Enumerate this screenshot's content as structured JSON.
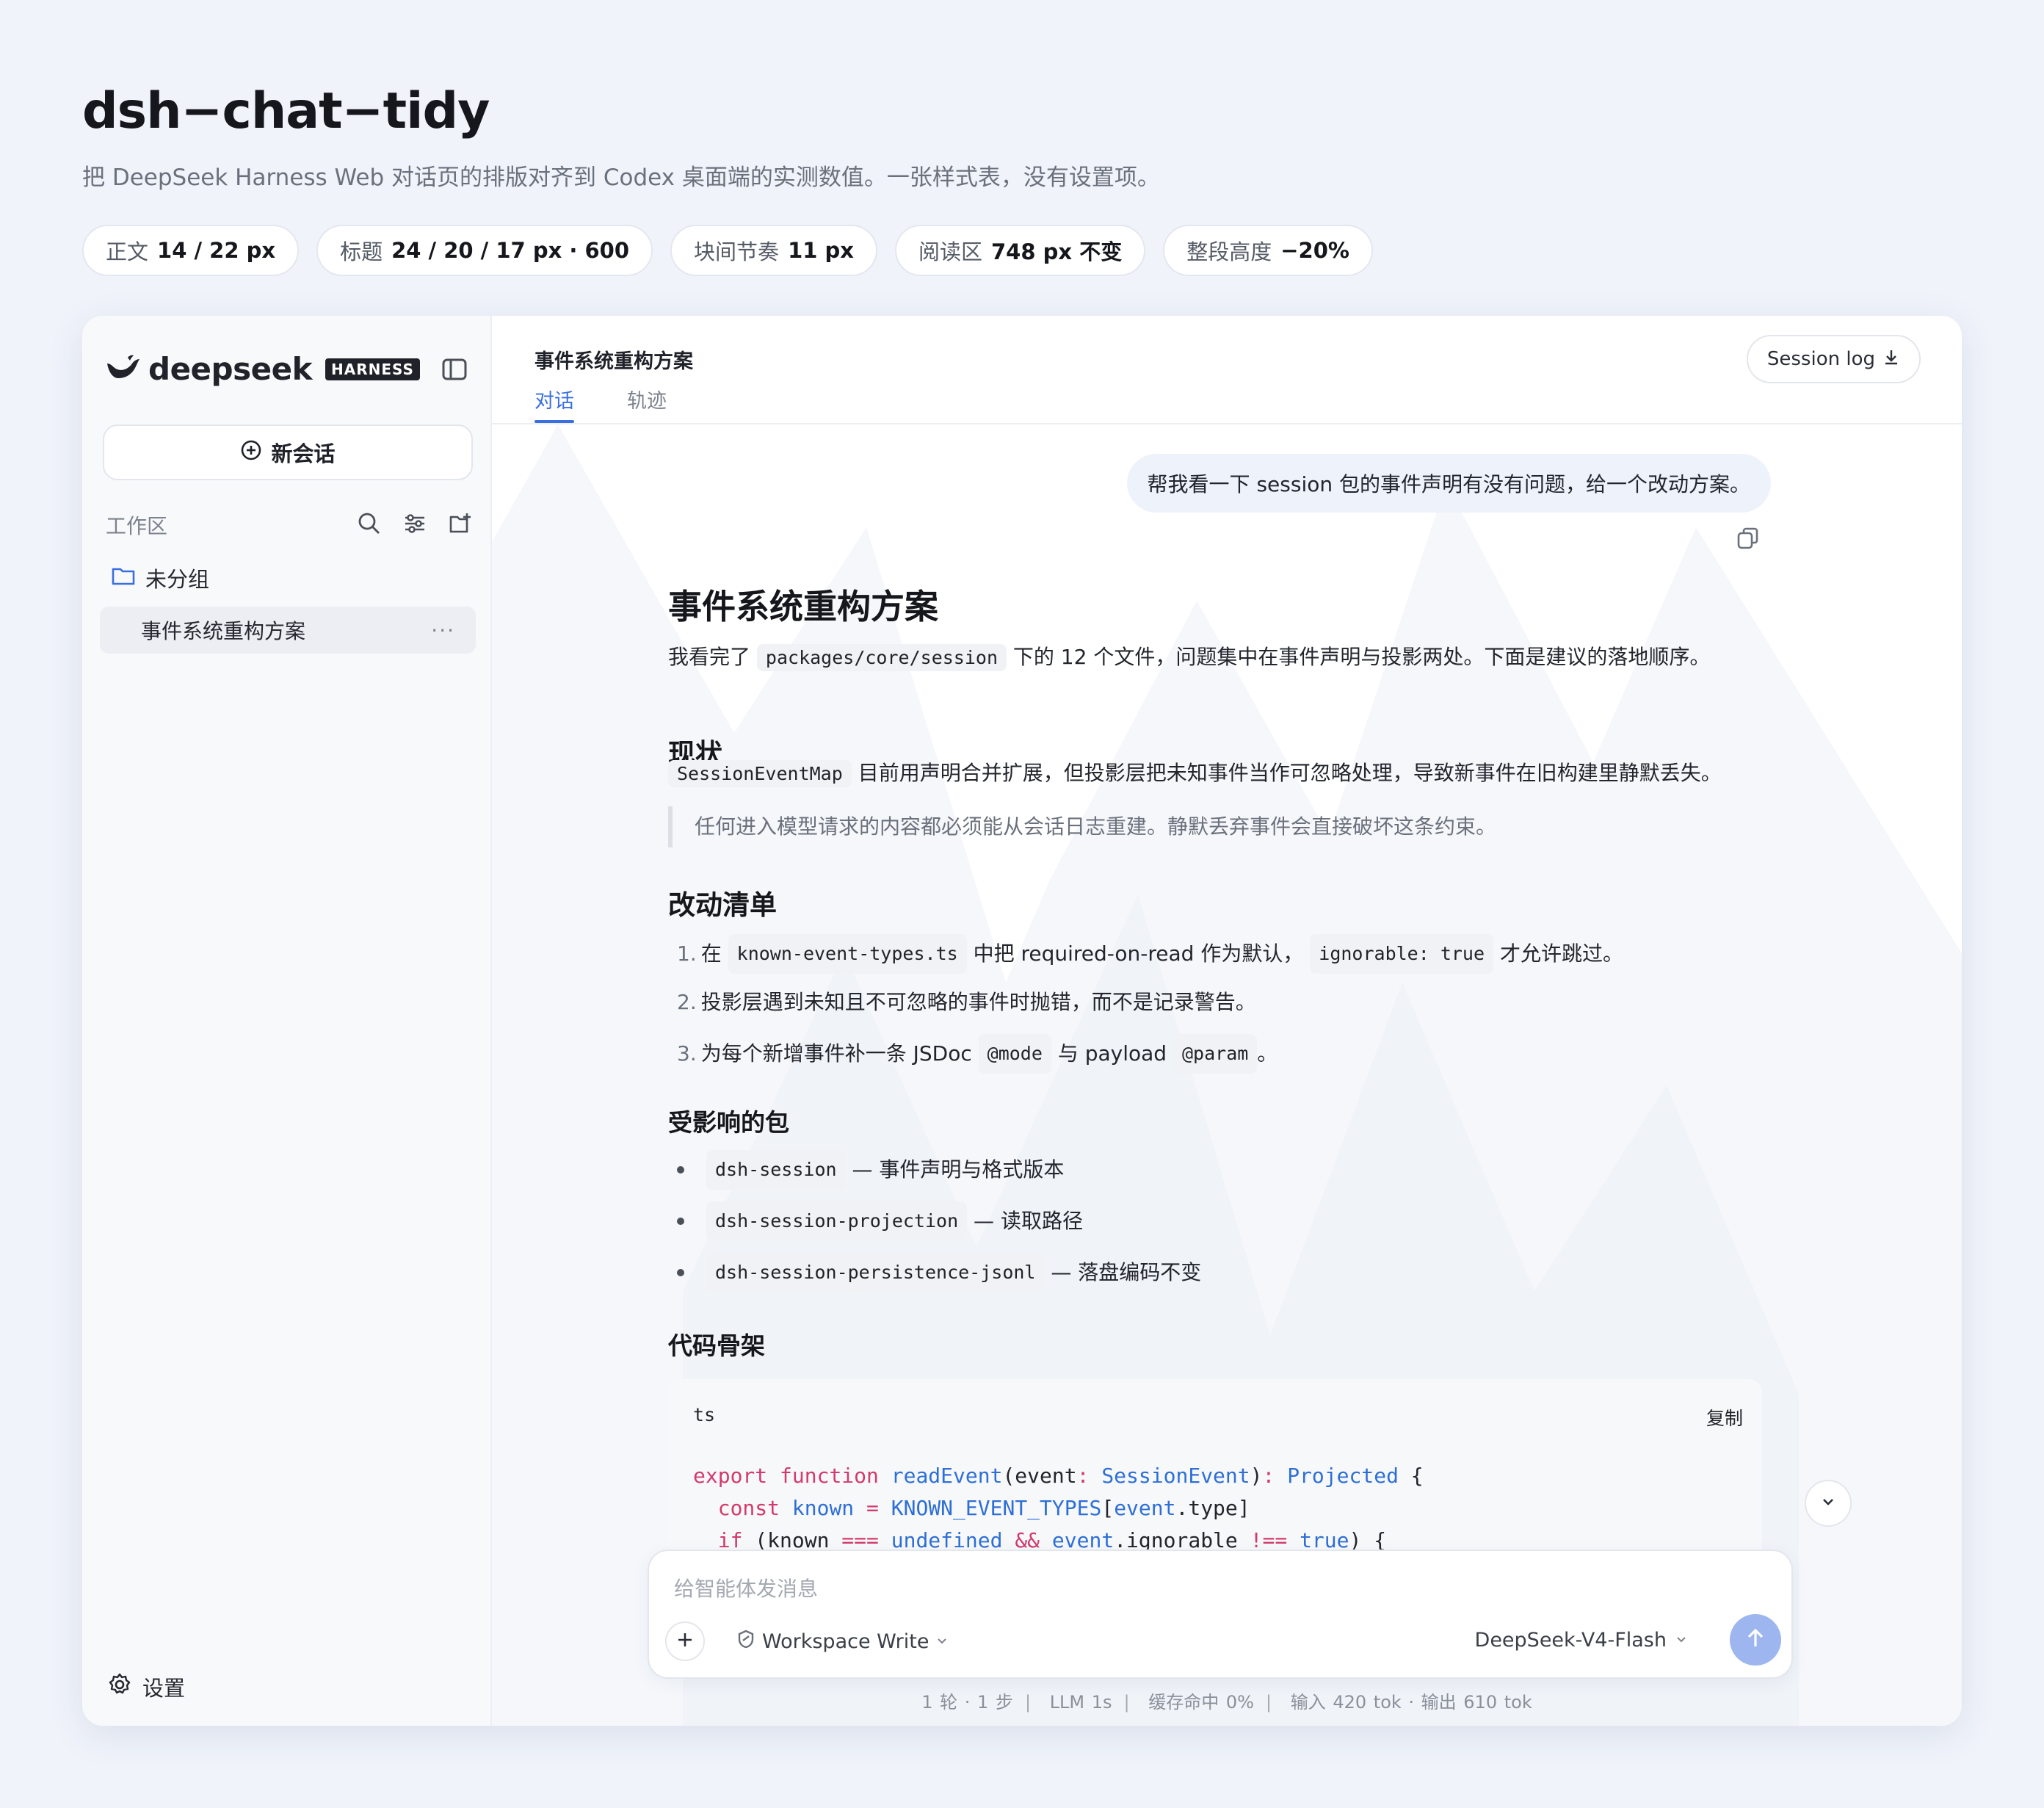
{
  "page": {
    "title": "dsh−chat−tidy",
    "subtitle": "把 DeepSeek Harness Web 对话页的排版对齐到 Codex 桌面端的实测数值。一张样式表，没有设置项。",
    "chips": [
      {
        "key": "正文",
        "value": "14 / 22 px"
      },
      {
        "key": "标题",
        "value": "24 / 20 / 17 px · 600"
      },
      {
        "key": "块间节奏",
        "value": "11 px"
      },
      {
        "key": "阅读区",
        "value": "748 px 不变"
      },
      {
        "key": "整段高度",
        "value": "−20%"
      }
    ]
  },
  "sidebar": {
    "logo_text": "deepseek",
    "logo_badge": "HARNESS",
    "new_chat_label": "新会话",
    "workspace_label": "工作区",
    "group_label": "未分组",
    "session_item_label": "事件系统重构方案",
    "session_item_more": "···",
    "settings_label": "设置"
  },
  "header": {
    "conversation_title": "事件系统重构方案",
    "tabs": [
      "对话",
      "轨迹"
    ],
    "session_log_label": "Session log"
  },
  "chat": {
    "user_message": "帮我看一下 session 包的事件声明有没有问题，给一个改动方案。",
    "answer_title": "事件系统重构方案",
    "intro_before": "我看完了",
    "intro_code": "packages/core/session",
    "intro_after": "下的 12 个文件，问题集中在事件声明与投影两处。下面是建议的落地顺序。",
    "h_status": "现状",
    "status_code": "SessionEventMap",
    "status_text": "目前用声明合并扩展，但投影层把未知事件当作可忽略处理，导致新事件在旧构建里静默丢失。",
    "quote": "任何进入模型请求的内容都必须能从会话日志重建。静默丢弃事件会直接破坏这条约束。",
    "h_changes": "改动清单",
    "item1_num": "1.",
    "item1_a": "在",
    "item1_code1": "known-event-types.ts",
    "item1_b": "中把 required-on-read 作为默认，",
    "item1_code2": "ignorable: true",
    "item1_c": "才允许跳过。",
    "item2_num": "2.",
    "item2": "投影层遇到未知且不可忽略的事件时抛错，而不是记录警告。",
    "item3_num": "3.",
    "item3_a": "为每个新增事件补一条 JSDoc",
    "item3_code1": "@mode",
    "item3_b": "与 payload",
    "item3_code2": "@param",
    "item3_c": "。",
    "h_packages": "受影响的包",
    "packages": [
      {
        "code": "dsh-session",
        "desc": "— 事件声明与格式版本"
      },
      {
        "code": "dsh-session-projection",
        "desc": "— 读取路径"
      },
      {
        "code": "dsh-session-persistence-jsonl",
        "desc": "— 落盘编码不变"
      }
    ],
    "h_code": "代码骨架",
    "code_lang": "ts",
    "code_copy": "复制"
  },
  "composer": {
    "placeholder": "给智能体发消息",
    "mode_label": "Workspace Write",
    "model_label": "DeepSeek-V4-Flash"
  },
  "status": {
    "turns": "1 轮 · 1 步",
    "llm": "LLM 1s",
    "cache": "缓存命中 0%",
    "tokens": "输入 420 tok · 输出 610 tok"
  },
  "colors": {
    "accent": "#3b6fe0",
    "send_button": "#9db6ef",
    "keyword": "#d23b6b",
    "identifier": "#2e6fd6"
  }
}
